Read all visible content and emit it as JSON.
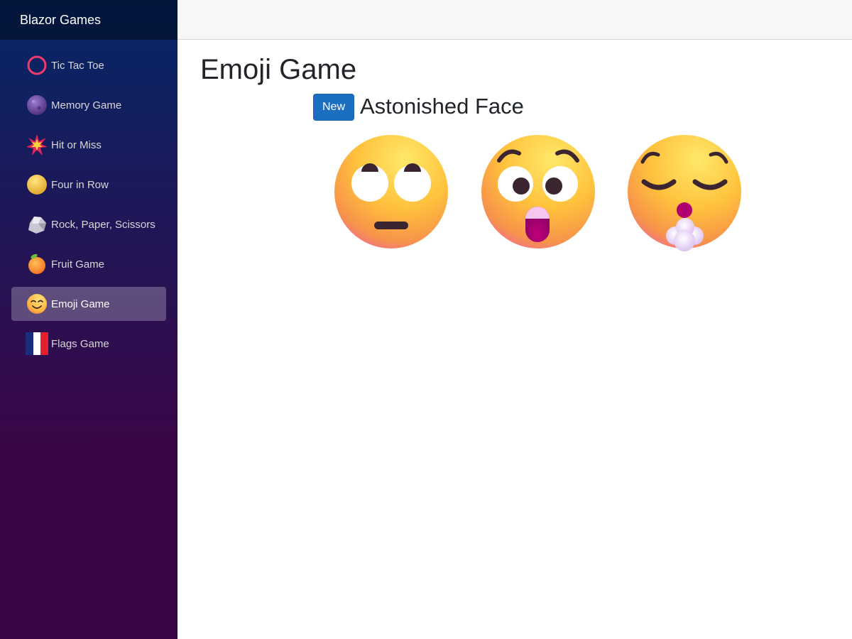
{
  "app": {
    "brand": "Blazor Games"
  },
  "sidebar": {
    "items": [
      {
        "label": "Tic Tac Toe",
        "icon": "ring-icon"
      },
      {
        "label": "Memory Game",
        "icon": "purple-orb-icon"
      },
      {
        "label": "Hit or Miss",
        "icon": "explosion-icon"
      },
      {
        "label": "Four in Row",
        "icon": "yellow-disc-icon"
      },
      {
        "label": "Rock, Paper, Scissors",
        "icon": "rock-icon"
      },
      {
        "label": "Fruit Game",
        "icon": "tangerine-icon"
      },
      {
        "label": "Emoji Game",
        "icon": "smiling-face-icon",
        "active": true
      },
      {
        "label": "Flags Game",
        "icon": "france-flag-icon"
      }
    ]
  },
  "main": {
    "title": "Emoji Game",
    "new_button": "New",
    "target": "Astonished Face",
    "options": [
      {
        "name": "face-with-rolling-eyes-icon"
      },
      {
        "name": "astonished-face-icon"
      },
      {
        "name": "face-exhaling-icon"
      }
    ]
  },
  "colors": {
    "sidebar_top": "#052767",
    "sidebar_bottom": "#3a0647",
    "button": "#1b6ec2",
    "topbar": "#f7f7f7"
  }
}
